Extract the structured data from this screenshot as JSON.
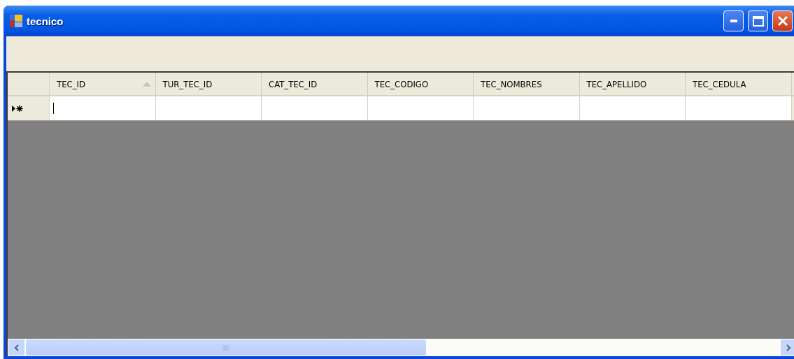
{
  "window": {
    "title": "tecnico"
  },
  "grid": {
    "columns": [
      {
        "label": "TEC_ID",
        "sorted": true
      },
      {
        "label": "TUR_TEC_ID",
        "sorted": false
      },
      {
        "label": "CAT_TEC_ID",
        "sorted": false
      },
      {
        "label": "TEC_CODIGO",
        "sorted": false
      },
      {
        "label": "TEC_NOMBRES",
        "sorted": false
      },
      {
        "label": "TEC_APELLIDO",
        "sorted": false
      },
      {
        "label": "TEC_CEDULA",
        "sorted": false
      }
    ],
    "new_row": {
      "cells": [
        {
          "editing": true
        },
        {
          "editing": false
        },
        {
          "editing": false
        },
        {
          "editing": false
        },
        {
          "editing": false
        },
        {
          "editing": false
        },
        {
          "editing": false
        }
      ]
    }
  }
}
